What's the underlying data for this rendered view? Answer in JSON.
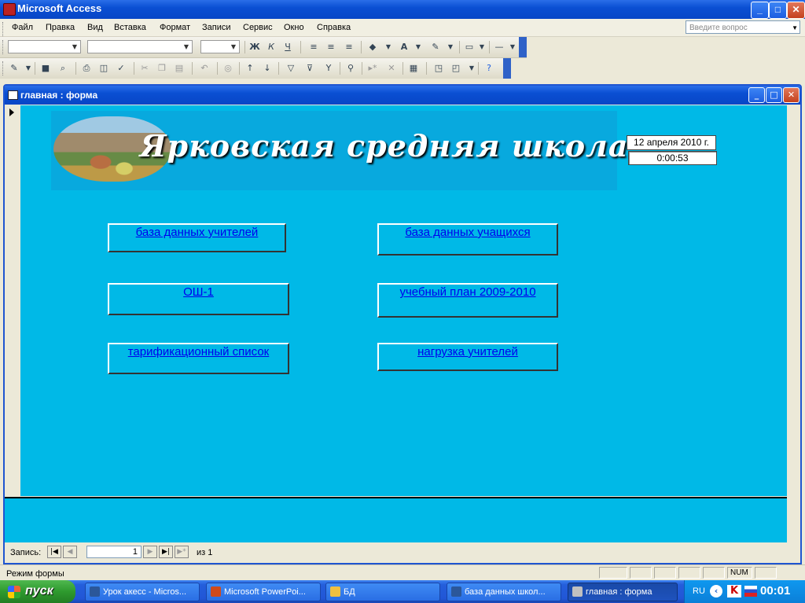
{
  "app": {
    "title": "Microsoft Access"
  },
  "window_controls": {
    "minimize": "_",
    "maximize": "□",
    "close": "✕"
  },
  "menu": {
    "items": [
      {
        "label": "Файл"
      },
      {
        "label": "Правка"
      },
      {
        "label": "Вид"
      },
      {
        "label": "Вставка"
      },
      {
        "label": "Формат"
      },
      {
        "label": "Записи"
      },
      {
        "label": "Сервис"
      },
      {
        "label": "Окно"
      },
      {
        "label": "Справка"
      }
    ],
    "help_placeholder": "Введите вопрос"
  },
  "toolbar_format": {
    "bold": "Ж",
    "italic": "К",
    "underline": "Ч",
    "font_color_icon": "A"
  },
  "form_window": {
    "title": "главная : форма"
  },
  "banner": {
    "title": "Ярковская средняя школа",
    "photo": "school-photo"
  },
  "date": "12 апреля 2010 г.",
  "time": "0:00:53",
  "buttons": [
    {
      "label": "база данных учителей"
    },
    {
      "label": "база данных учащихся"
    },
    {
      "label": "ОШ-1"
    },
    {
      "label": "учебный план 2009-2010 "
    },
    {
      "label": "тарификационный список"
    },
    {
      "label": "нагрузка учителей"
    }
  ],
  "navigation": {
    "label": "Запись:",
    "current": "1",
    "of": "из 1"
  },
  "status": {
    "text": "Режим формы",
    "num": "NUM"
  },
  "taskbar": {
    "start": "пуск",
    "tasks": [
      {
        "label": "Урок акесс - Micros...",
        "icon_color": "#2b579a"
      },
      {
        "label": "Microsoft PowerPoi...",
        "icon_color": "#d04a1c"
      },
      {
        "label": "БД",
        "icon_color": "#f0c040"
      },
      {
        "label": "база данных школ...",
        "icon_color": "#2b579a"
      },
      {
        "label": "главная : форма",
        "icon_color": "#c0c0c0"
      }
    ],
    "lang": "RU",
    "clock": "00:01"
  },
  "colors": {
    "form_background": "#00b9e7",
    "banner_background": "#08a9de",
    "link": "#0000ee",
    "titlebar": "#0a4fd3"
  }
}
